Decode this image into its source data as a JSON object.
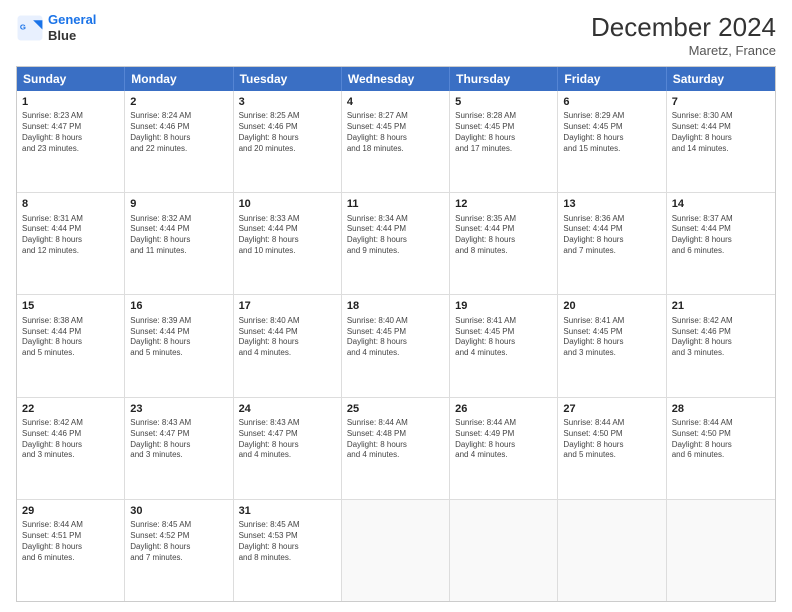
{
  "header": {
    "logo_line1": "General",
    "logo_line2": "Blue",
    "month_title": "December 2024",
    "location": "Maretz, France"
  },
  "days_of_week": [
    "Sunday",
    "Monday",
    "Tuesday",
    "Wednesday",
    "Thursday",
    "Friday",
    "Saturday"
  ],
  "weeks": [
    [
      {
        "day": "1",
        "lines": [
          "Sunrise: 8:23 AM",
          "Sunset: 4:47 PM",
          "Daylight: 8 hours",
          "and 23 minutes."
        ]
      },
      {
        "day": "2",
        "lines": [
          "Sunrise: 8:24 AM",
          "Sunset: 4:46 PM",
          "Daylight: 8 hours",
          "and 22 minutes."
        ]
      },
      {
        "day": "3",
        "lines": [
          "Sunrise: 8:25 AM",
          "Sunset: 4:46 PM",
          "Daylight: 8 hours",
          "and 20 minutes."
        ]
      },
      {
        "day": "4",
        "lines": [
          "Sunrise: 8:27 AM",
          "Sunset: 4:45 PM",
          "Daylight: 8 hours",
          "and 18 minutes."
        ]
      },
      {
        "day": "5",
        "lines": [
          "Sunrise: 8:28 AM",
          "Sunset: 4:45 PM",
          "Daylight: 8 hours",
          "and 17 minutes."
        ]
      },
      {
        "day": "6",
        "lines": [
          "Sunrise: 8:29 AM",
          "Sunset: 4:45 PM",
          "Daylight: 8 hours",
          "and 15 minutes."
        ]
      },
      {
        "day": "7",
        "lines": [
          "Sunrise: 8:30 AM",
          "Sunset: 4:44 PM",
          "Daylight: 8 hours",
          "and 14 minutes."
        ]
      }
    ],
    [
      {
        "day": "8",
        "lines": [
          "Sunrise: 8:31 AM",
          "Sunset: 4:44 PM",
          "Daylight: 8 hours",
          "and 12 minutes."
        ]
      },
      {
        "day": "9",
        "lines": [
          "Sunrise: 8:32 AM",
          "Sunset: 4:44 PM",
          "Daylight: 8 hours",
          "and 11 minutes."
        ]
      },
      {
        "day": "10",
        "lines": [
          "Sunrise: 8:33 AM",
          "Sunset: 4:44 PM",
          "Daylight: 8 hours",
          "and 10 minutes."
        ]
      },
      {
        "day": "11",
        "lines": [
          "Sunrise: 8:34 AM",
          "Sunset: 4:44 PM",
          "Daylight: 8 hours",
          "and 9 minutes."
        ]
      },
      {
        "day": "12",
        "lines": [
          "Sunrise: 8:35 AM",
          "Sunset: 4:44 PM",
          "Daylight: 8 hours",
          "and 8 minutes."
        ]
      },
      {
        "day": "13",
        "lines": [
          "Sunrise: 8:36 AM",
          "Sunset: 4:44 PM",
          "Daylight: 8 hours",
          "and 7 minutes."
        ]
      },
      {
        "day": "14",
        "lines": [
          "Sunrise: 8:37 AM",
          "Sunset: 4:44 PM",
          "Daylight: 8 hours",
          "and 6 minutes."
        ]
      }
    ],
    [
      {
        "day": "15",
        "lines": [
          "Sunrise: 8:38 AM",
          "Sunset: 4:44 PM",
          "Daylight: 8 hours",
          "and 5 minutes."
        ]
      },
      {
        "day": "16",
        "lines": [
          "Sunrise: 8:39 AM",
          "Sunset: 4:44 PM",
          "Daylight: 8 hours",
          "and 5 minutes."
        ]
      },
      {
        "day": "17",
        "lines": [
          "Sunrise: 8:40 AM",
          "Sunset: 4:44 PM",
          "Daylight: 8 hours",
          "and 4 minutes."
        ]
      },
      {
        "day": "18",
        "lines": [
          "Sunrise: 8:40 AM",
          "Sunset: 4:45 PM",
          "Daylight: 8 hours",
          "and 4 minutes."
        ]
      },
      {
        "day": "19",
        "lines": [
          "Sunrise: 8:41 AM",
          "Sunset: 4:45 PM",
          "Daylight: 8 hours",
          "and 4 minutes."
        ]
      },
      {
        "day": "20",
        "lines": [
          "Sunrise: 8:41 AM",
          "Sunset: 4:45 PM",
          "Daylight: 8 hours",
          "and 3 minutes."
        ]
      },
      {
        "day": "21",
        "lines": [
          "Sunrise: 8:42 AM",
          "Sunset: 4:46 PM",
          "Daylight: 8 hours",
          "and 3 minutes."
        ]
      }
    ],
    [
      {
        "day": "22",
        "lines": [
          "Sunrise: 8:42 AM",
          "Sunset: 4:46 PM",
          "Daylight: 8 hours",
          "and 3 minutes."
        ]
      },
      {
        "day": "23",
        "lines": [
          "Sunrise: 8:43 AM",
          "Sunset: 4:47 PM",
          "Daylight: 8 hours",
          "and 3 minutes."
        ]
      },
      {
        "day": "24",
        "lines": [
          "Sunrise: 8:43 AM",
          "Sunset: 4:47 PM",
          "Daylight: 8 hours",
          "and 4 minutes."
        ]
      },
      {
        "day": "25",
        "lines": [
          "Sunrise: 8:44 AM",
          "Sunset: 4:48 PM",
          "Daylight: 8 hours",
          "and 4 minutes."
        ]
      },
      {
        "day": "26",
        "lines": [
          "Sunrise: 8:44 AM",
          "Sunset: 4:49 PM",
          "Daylight: 8 hours",
          "and 4 minutes."
        ]
      },
      {
        "day": "27",
        "lines": [
          "Sunrise: 8:44 AM",
          "Sunset: 4:50 PM",
          "Daylight: 8 hours",
          "and 5 minutes."
        ]
      },
      {
        "day": "28",
        "lines": [
          "Sunrise: 8:44 AM",
          "Sunset: 4:50 PM",
          "Daylight: 8 hours",
          "and 6 minutes."
        ]
      }
    ],
    [
      {
        "day": "29",
        "lines": [
          "Sunrise: 8:44 AM",
          "Sunset: 4:51 PM",
          "Daylight: 8 hours",
          "and 6 minutes."
        ]
      },
      {
        "day": "30",
        "lines": [
          "Sunrise: 8:45 AM",
          "Sunset: 4:52 PM",
          "Daylight: 8 hours",
          "and 7 minutes."
        ]
      },
      {
        "day": "31",
        "lines": [
          "Sunrise: 8:45 AM",
          "Sunset: 4:53 PM",
          "Daylight: 8 hours",
          "and 8 minutes."
        ]
      },
      null,
      null,
      null,
      null
    ]
  ]
}
